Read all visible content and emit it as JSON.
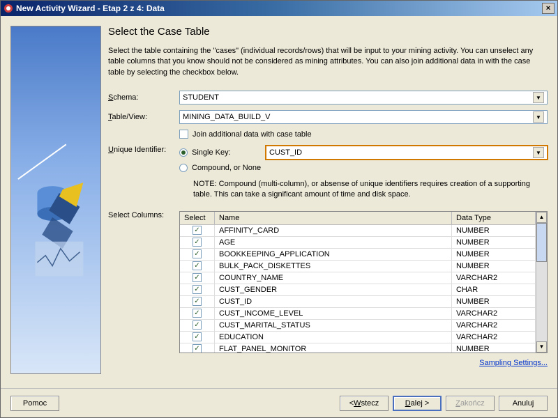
{
  "titlebar": {
    "title": "New Activity Wizard - Etap 2 z 4: Data",
    "close": "×"
  },
  "page": {
    "heading": "Select the Case Table",
    "description": "Select the table containing the \"cases\" (individual records/rows) that will be input to your mining activity.  You can unselect any table columns that you know should not be considered as mining attributes.  You can also join additional data in with the case table by selecting the checkbox below."
  },
  "form": {
    "schema_label": "Schema:",
    "schema_value": "STUDENT",
    "table_label": "Table/View:",
    "table_value": "MINING_DATA_BUILD_V",
    "join_label": "Join additional data with case table",
    "uid_label": "Unique Identifier:",
    "single_key_label": "Single Key:",
    "single_key_value": "CUST_ID",
    "compound_label": "Compound, or None",
    "note": "NOTE: Compound (multi-column), or absense of unique identifiers requires creation of a supporting table. This can take a significant amount of time and disk space.",
    "select_columns_label": "Select Columns:"
  },
  "grid": {
    "headers": {
      "select": "Select",
      "name": "Name",
      "data_type": "Data Type"
    },
    "rows": [
      {
        "checked": true,
        "name": "AFFINITY_CARD",
        "type": "NUMBER"
      },
      {
        "checked": true,
        "name": "AGE",
        "type": "NUMBER"
      },
      {
        "checked": true,
        "name": "BOOKKEEPING_APPLICATION",
        "type": "NUMBER"
      },
      {
        "checked": true,
        "name": "BULK_PACK_DISKETTES",
        "type": "NUMBER"
      },
      {
        "checked": true,
        "name": "COUNTRY_NAME",
        "type": "VARCHAR2"
      },
      {
        "checked": true,
        "name": "CUST_GENDER",
        "type": "CHAR"
      },
      {
        "checked": true,
        "name": "CUST_ID",
        "type": "NUMBER"
      },
      {
        "checked": true,
        "name": "CUST_INCOME_LEVEL",
        "type": "VARCHAR2"
      },
      {
        "checked": true,
        "name": "CUST_MARITAL_STATUS",
        "type": "VARCHAR2"
      },
      {
        "checked": true,
        "name": "EDUCATION",
        "type": "VARCHAR2"
      },
      {
        "checked": true,
        "name": "FLAT_PANEL_MONITOR",
        "type": "NUMBER"
      }
    ]
  },
  "links": {
    "sampling": "Sampling Settings..."
  },
  "footer": {
    "help": "Pomoc",
    "back": "< Wstecz",
    "next": "Dalej >",
    "finish": "Zakończ",
    "cancel": "Anuluj"
  }
}
